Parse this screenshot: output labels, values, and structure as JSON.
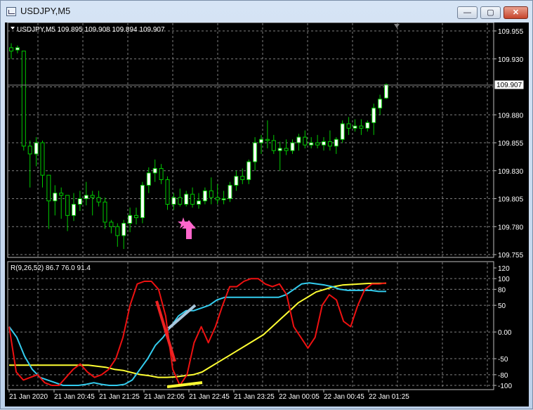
{
  "window": {
    "title": "USDJPY,M5",
    "minimize_glyph": "—",
    "maximize_glyph": "▢",
    "close_glyph": "✕"
  },
  "main_chart": {
    "header": "USDJPY,M5  109.895 109.908 109.894 109.907",
    "price_ticks": [
      "109.955",
      "109.930",
      "109.905",
      "109.880",
      "109.855",
      "109.830",
      "109.805",
      "109.780",
      "109.755"
    ],
    "current_price": "109.907",
    "colors": {
      "background": "#000000",
      "bull": "#ffffff",
      "bear": "#000000",
      "wick": "#00cc00",
      "grid": "#7f7f7f",
      "marker": "#ff66cc"
    },
    "candles": [
      [
        109.94,
        109.944,
        109.93,
        109.937
      ],
      [
        109.938,
        109.942,
        109.935,
        109.94
      ],
      [
        109.937,
        109.937,
        109.848,
        109.852
      ],
      [
        109.852,
        109.857,
        109.815,
        109.845
      ],
      [
        109.845,
        109.86,
        109.834,
        109.855
      ],
      [
        109.855,
        109.857,
        109.815,
        109.826
      ],
      [
        109.826,
        109.826,
        109.778,
        109.803
      ],
      [
        109.803,
        109.817,
        109.79,
        109.81
      ],
      [
        109.81,
        109.815,
        109.787,
        109.808
      ],
      [
        109.808,
        109.808,
        109.776,
        109.79
      ],
      [
        109.79,
        109.81,
        109.785,
        109.8
      ],
      [
        109.8,
        109.812,
        109.794,
        109.805
      ],
      [
        109.805,
        109.82,
        109.799,
        109.808
      ],
      [
        109.808,
        109.812,
        109.79,
        109.806
      ],
      [
        109.806,
        109.812,
        109.798,
        109.802
      ],
      [
        109.802,
        109.806,
        109.778,
        109.784
      ],
      [
        109.784,
        109.786,
        109.774,
        109.78
      ],
      [
        109.78,
        109.783,
        109.762,
        109.772
      ],
      [
        109.772,
        109.786,
        109.76,
        109.783
      ],
      [
        109.783,
        109.797,
        109.775,
        109.79
      ],
      [
        109.79,
        109.797,
        109.782,
        109.788
      ],
      [
        109.788,
        109.82,
        109.783,
        109.817
      ],
      [
        109.817,
        109.833,
        109.81,
        109.828
      ],
      [
        109.828,
        109.84,
        109.82,
        109.832
      ],
      [
        109.832,
        109.836,
        109.818,
        109.822
      ],
      [
        109.822,
        109.825,
        109.795,
        109.8
      ],
      [
        109.8,
        109.81,
        109.795,
        109.806
      ],
      [
        109.806,
        109.814,
        109.798,
        109.8
      ],
      [
        109.8,
        109.812,
        109.798,
        109.809
      ],
      [
        109.809,
        109.815,
        109.797,
        109.8
      ],
      [
        109.8,
        109.81,
        109.796,
        109.803
      ],
      [
        109.803,
        109.815,
        109.8,
        109.812
      ],
      [
        109.812,
        109.824,
        109.8,
        109.806
      ],
      [
        109.806,
        109.818,
        109.8,
        109.804
      ],
      [
        109.804,
        109.812,
        109.8,
        109.805
      ],
      [
        109.805,
        109.82,
        109.802,
        109.817
      ],
      [
        109.817,
        109.83,
        109.812,
        109.825
      ],
      [
        109.825,
        109.832,
        109.818,
        109.822
      ],
      [
        109.822,
        109.84,
        109.818,
        109.838
      ],
      [
        109.838,
        109.86,
        109.83,
        109.855
      ],
      [
        109.855,
        109.862,
        109.845,
        109.858
      ],
      [
        109.858,
        109.875,
        109.85,
        109.857
      ],
      [
        109.857,
        109.862,
        109.845,
        109.848
      ],
      [
        109.848,
        109.856,
        109.83,
        109.85
      ],
      [
        109.85,
        109.858,
        109.844,
        109.848
      ],
      [
        109.848,
        109.858,
        109.845,
        109.855
      ],
      [
        109.855,
        109.863,
        109.848,
        109.86
      ],
      [
        109.86,
        109.866,
        109.85,
        109.853
      ],
      [
        109.853,
        109.86,
        109.85,
        109.855
      ],
      [
        109.855,
        109.862,
        109.85,
        109.853
      ],
      [
        109.853,
        109.86,
        109.848,
        109.856
      ],
      [
        109.856,
        109.866,
        109.848,
        109.852
      ],
      [
        109.852,
        109.86,
        109.845,
        109.858
      ],
      [
        109.858,
        109.875,
        109.855,
        109.872
      ],
      [
        109.872,
        109.878,
        109.862,
        109.868
      ],
      [
        109.868,
        109.876,
        109.865,
        109.87
      ],
      [
        109.87,
        109.876,
        109.862,
        109.868
      ],
      [
        109.868,
        109.875,
        109.865,
        109.873
      ],
      [
        109.873,
        109.89,
        109.862,
        109.886
      ],
      [
        109.886,
        109.898,
        109.88,
        109.894
      ],
      [
        109.895,
        109.908,
        109.894,
        109.907
      ]
    ]
  },
  "indicator": {
    "header": "R(9,26,52) 86.7 76.0 91.4",
    "ticks": [
      "120",
      "100",
      "80",
      "50",
      "0.00",
      "-50",
      "-80",
      "-100"
    ],
    "colors": {
      "red": "#ee1111",
      "cyan": "#33ccee",
      "yellow": "#ffff33"
    },
    "red": [
      10,
      -75,
      -90,
      -85,
      -80,
      -95,
      -100,
      -100,
      -85,
      -70,
      -60,
      -75,
      -85,
      -80,
      -70,
      -50,
      -10,
      50,
      90,
      95,
      95,
      80,
      30,
      -70,
      -100,
      -80,
      -20,
      10,
      -20,
      10,
      50,
      85,
      85,
      95,
      100,
      100,
      90,
      85,
      90,
      70,
      10,
      -10,
      -30,
      -10,
      50,
      70,
      60,
      20,
      10,
      50,
      80,
      90,
      90,
      92
    ],
    "cyan": [
      10,
      -10,
      -45,
      -70,
      -85,
      -90,
      -95,
      -100,
      -100,
      -100,
      -98,
      -95,
      -98,
      -100,
      -100,
      -98,
      -90,
      -70,
      -50,
      -25,
      -10,
      10,
      30,
      40,
      40,
      45,
      50,
      60,
      65,
      65,
      65,
      65,
      65,
      65,
      65,
      65,
      70,
      80,
      90,
      92,
      90,
      88,
      85,
      80,
      78,
      78,
      78,
      78,
      76,
      76
    ],
    "yellow": [
      -62,
      -62,
      -62,
      -62,
      -62,
      -62,
      -62,
      -62,
      -62,
      -62,
      -64,
      -66,
      -70,
      -72,
      -76,
      -80,
      -82,
      -85,
      -85,
      -84,
      -82,
      -80,
      -75,
      -65,
      -55,
      -45,
      -35,
      -25,
      -15,
      -5,
      10,
      25,
      40,
      55,
      65,
      75,
      80,
      85,
      88,
      89,
      90,
      91,
      91,
      91.4
    ]
  },
  "time_axis": [
    "21 Jan 2020",
    "21 Jan 20:45",
    "21 Jan 21:25",
    "21 Jan 22:05",
    "21 Jan 22:45",
    "21 Jan 23:25",
    "22 Jan 00:05",
    "22 Jan 00:45",
    "22 Jan 01:25"
  ]
}
